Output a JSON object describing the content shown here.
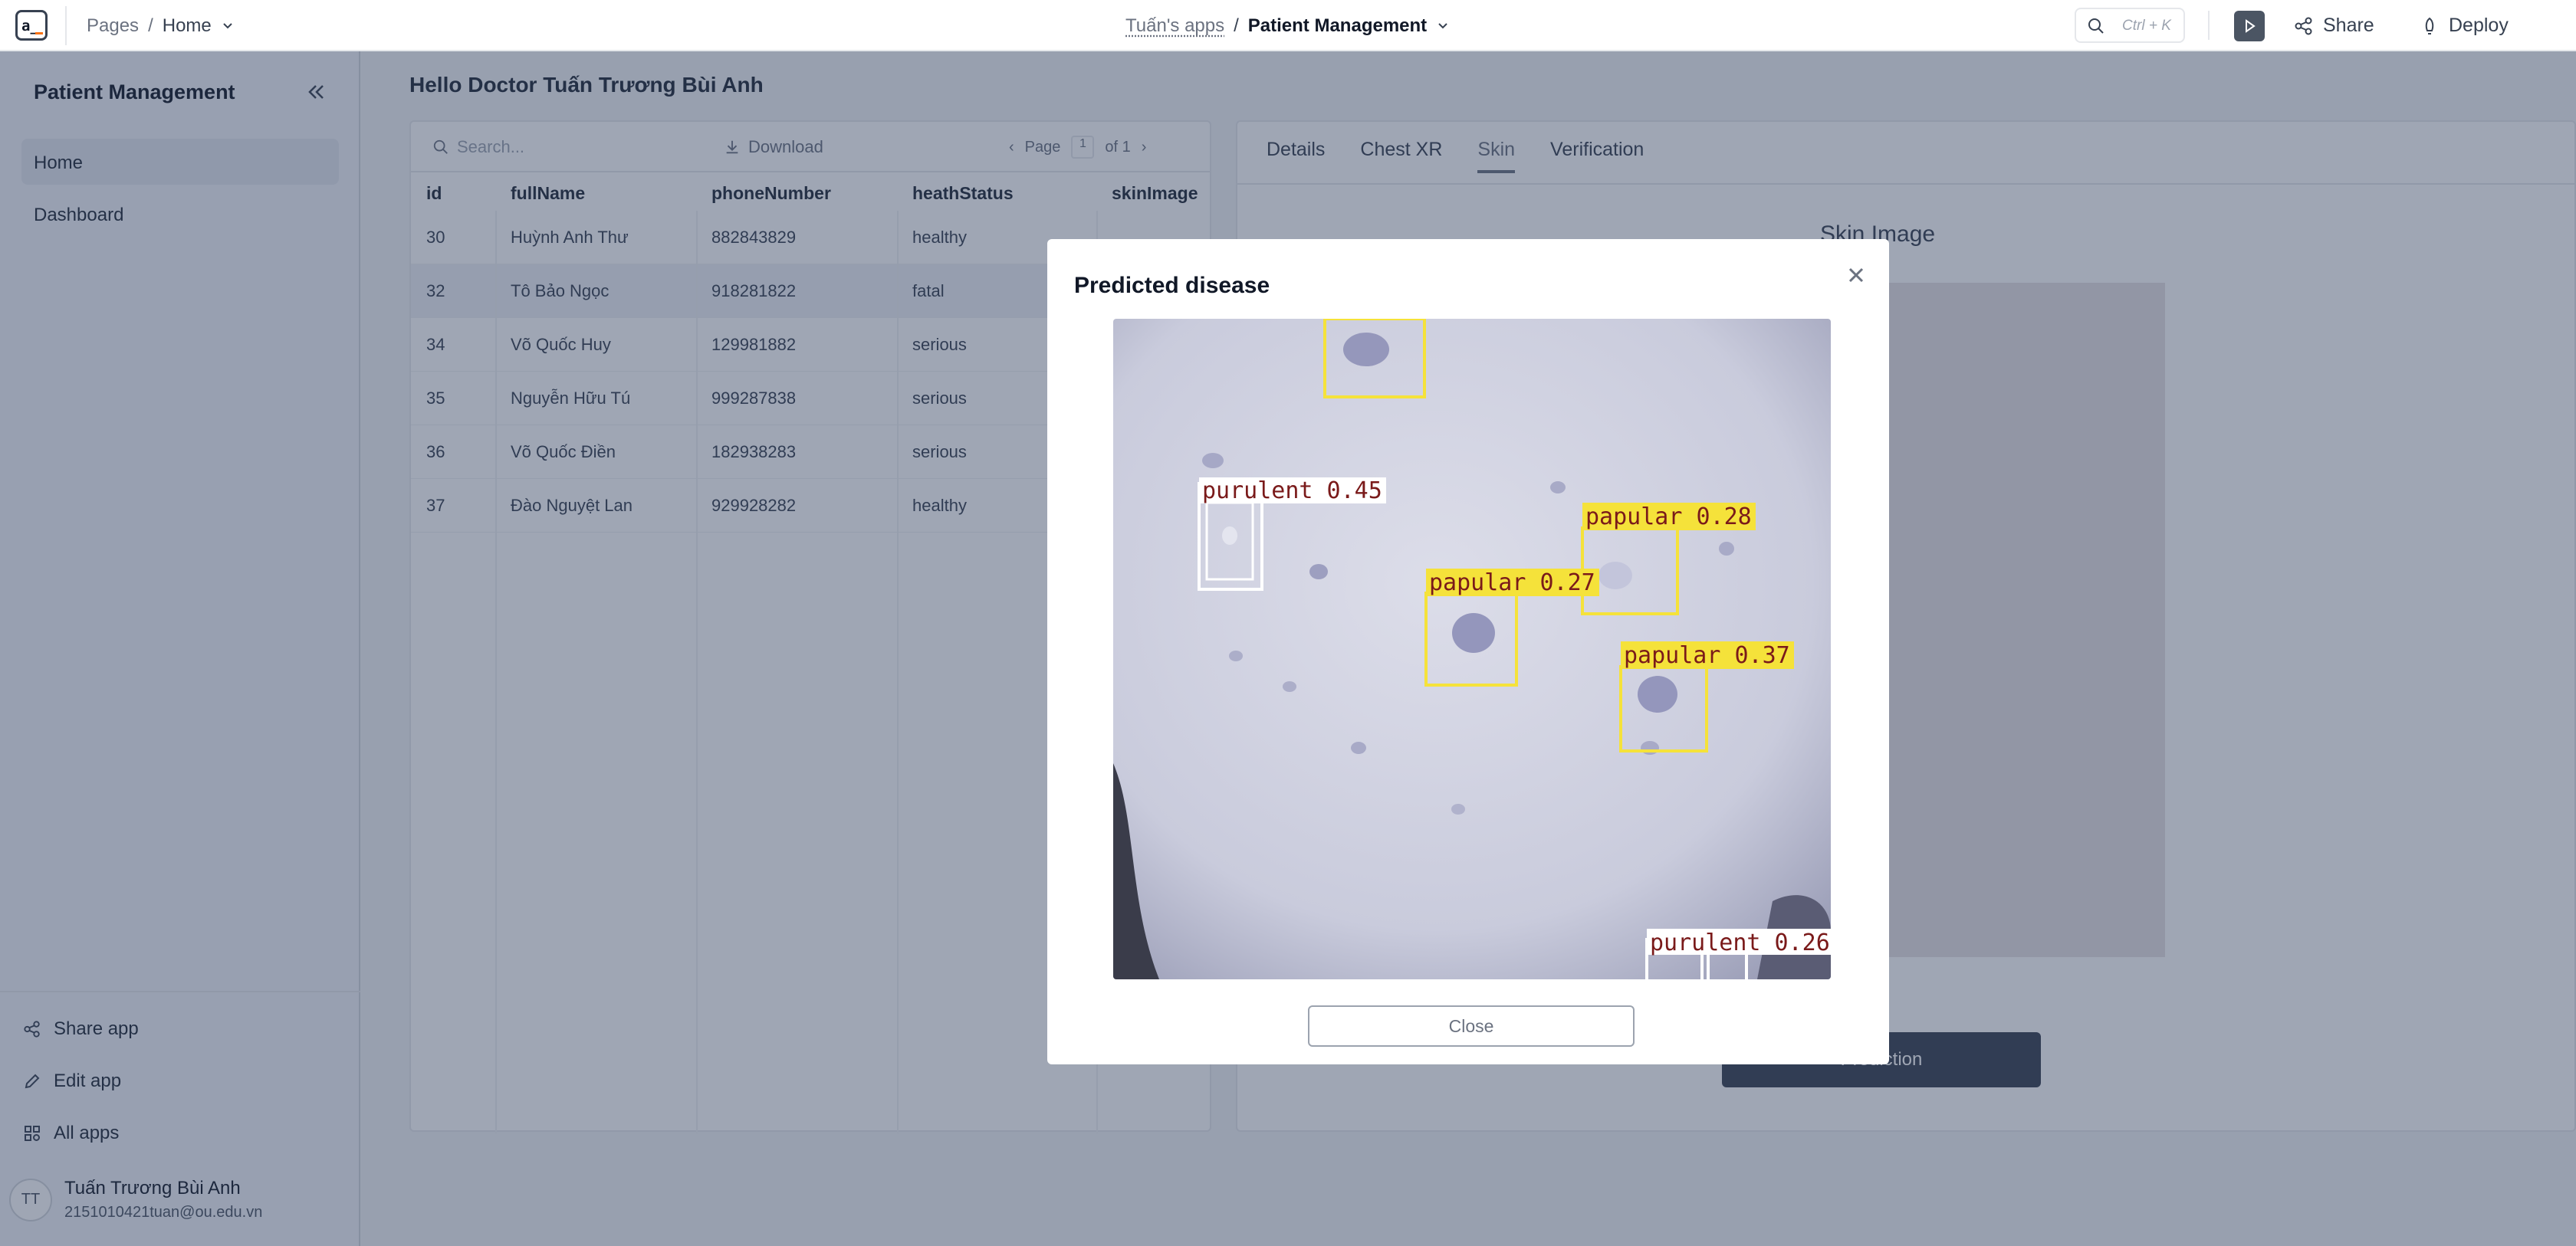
{
  "topbar": {
    "logo_text": "a_",
    "pages_label": "Pages",
    "page_current": "Home",
    "apps_label": "Tuấn's apps",
    "app_name": "Patient Management",
    "search_shortcut": "Ctrl + K",
    "share_label": "Share",
    "deploy_label": "Deploy"
  },
  "sidebar": {
    "title": "Patient Management",
    "items": [
      {
        "label": "Home",
        "active": true
      },
      {
        "label": "Dashboard",
        "active": false
      }
    ],
    "footer_links": [
      {
        "label": "Share app",
        "icon": "share-icon"
      },
      {
        "label": "Edit app",
        "icon": "pencil-icon"
      },
      {
        "label": "All apps",
        "icon": "apps-grid-icon"
      }
    ],
    "user": {
      "initials": "TT",
      "name": "Tuấn Trương Bùi Anh",
      "email": "2151010421tuan@ou.edu.vn"
    }
  },
  "main": {
    "greeting": "Hello Doctor Tuấn Trương Bùi Anh",
    "table": {
      "search_placeholder": "Search...",
      "download_label": "Download",
      "page_label": "Page",
      "page_current": "1",
      "page_of": "of 1",
      "columns": [
        "id",
        "fullName",
        "phoneNumber",
        "heathStatus",
        "skinImage"
      ],
      "rows": [
        {
          "id": "30",
          "fullName": "Huỳnh Anh Thư",
          "phoneNumber": "882843829",
          "heathStatus": "healthy"
        },
        {
          "id": "32",
          "fullName": "Tô Bảo Ngọc",
          "phoneNumber": "918281822",
          "heathStatus": "fatal"
        },
        {
          "id": "34",
          "fullName": "Võ Quốc Huy",
          "phoneNumber": "129981882",
          "heathStatus": "serious"
        },
        {
          "id": "35",
          "fullName": "Nguyễn Hữu Tú",
          "phoneNumber": "999287838",
          "heathStatus": "serious"
        },
        {
          "id": "36",
          "fullName": "Võ Quốc Điền",
          "phoneNumber": "182938283",
          "heathStatus": "serious"
        },
        {
          "id": "37",
          "fullName": "Đào Nguyệt Lan",
          "phoneNumber": "929928282",
          "heathStatus": "healthy"
        }
      ]
    },
    "tabs": [
      "Details",
      "Chest XR",
      "Skin",
      "Verification"
    ],
    "active_tab": "Skin",
    "skin_title": "Skin Image",
    "predict_button": "Prediction"
  },
  "modal": {
    "title": "Predicted disease",
    "close_label": "Close",
    "detections": [
      {
        "label": "purulent 0.45",
        "kind": "purulent"
      },
      {
        "label": "papular 0.28",
        "kind": "papular"
      },
      {
        "label": "papular 0.27",
        "kind": "papular"
      },
      {
        "label": "papular 0.37",
        "kind": "papular"
      },
      {
        "label": "purulent 0.26",
        "kind": "purulent"
      }
    ]
  },
  "colors": {
    "papular_box": "#f5e23a",
    "purulent_box": "#ffffff",
    "label_text": "#7a1a1a",
    "overlay": "#2a3a58"
  }
}
